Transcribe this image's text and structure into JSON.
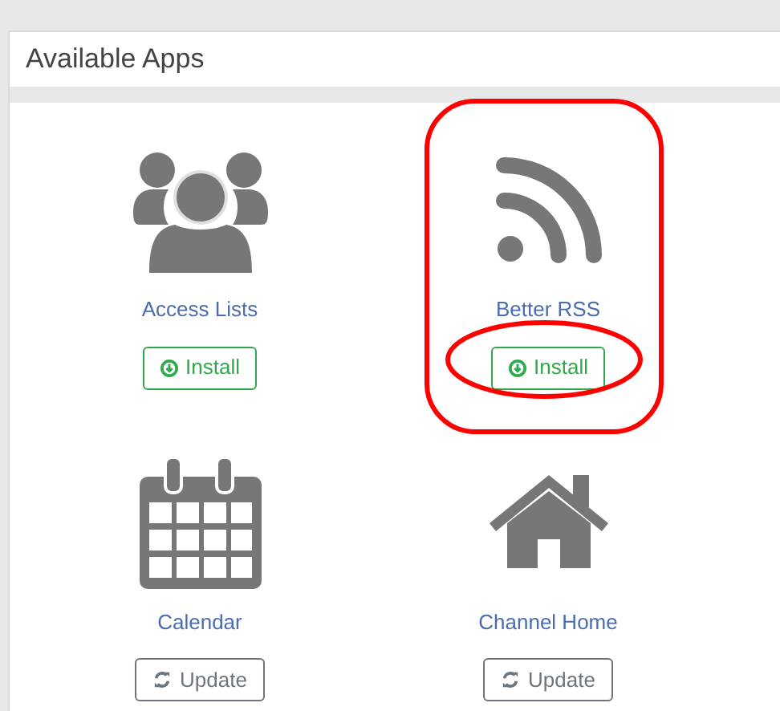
{
  "panel": {
    "title": "Available Apps"
  },
  "apps": [
    {
      "name": "Access Lists",
      "action": {
        "kind": "install",
        "label": "Install"
      },
      "highlighted": false
    },
    {
      "name": "Better RSS",
      "action": {
        "kind": "install",
        "label": "Install"
      },
      "highlighted": true
    },
    {
      "name": "Calendar",
      "action": {
        "kind": "update",
        "label": "Update"
      },
      "highlighted": false
    },
    {
      "name": "Channel Home",
      "action": {
        "kind": "update",
        "label": "Update"
      },
      "highlighted": false
    }
  ]
}
